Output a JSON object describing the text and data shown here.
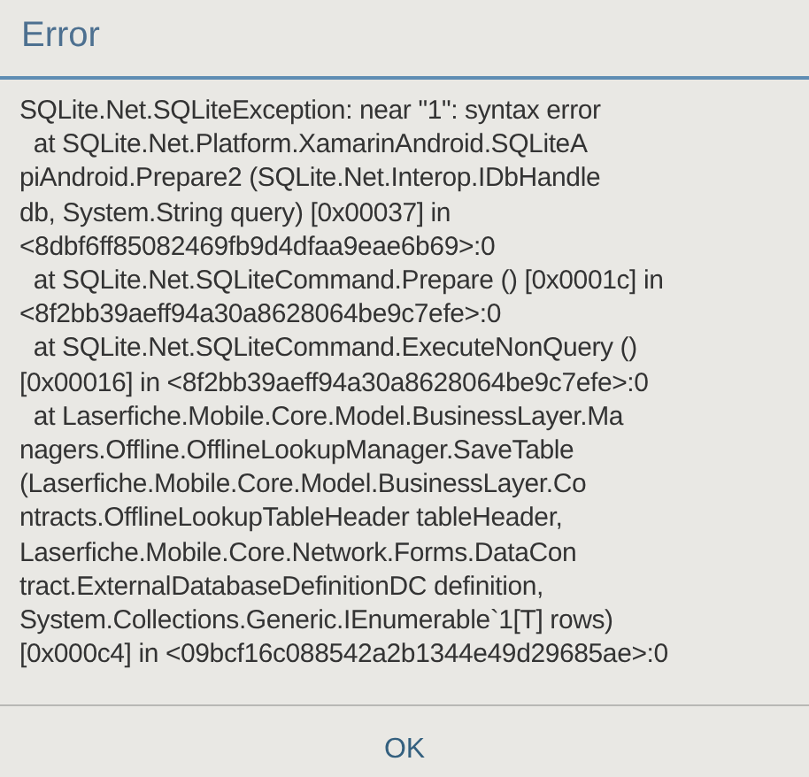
{
  "dialog": {
    "title": "Error",
    "message_lines": [
      "SQLite.Net.SQLiteException: near \"1\": syntax error",
      "  at SQLite.Net.Platform.XamarinAndroid.SQLiteA",
      "piAndroid.Prepare2 (SQLite.Net.Interop.IDbHandle",
      "db, System.String query) [0x00037] in",
      "<8dbf6ff85082469fb9d4dfaa9eae6b69>:0",
      "  at SQLite.Net.SQLiteCommand.Prepare () [0x0001c] in",
      "<8f2bb39aeff94a30a8628064be9c7efe>:0",
      "  at SQLite.Net.SQLiteCommand.ExecuteNonQuery ()",
      "[0x00016] in <8f2bb39aeff94a30a8628064be9c7efe>:0",
      "  at Laserfiche.Mobile.Core.Model.BusinessLayer.Ma",
      "nagers.Offline.OfflineLookupManager.SaveTable",
      "(Laserfiche.Mobile.Core.Model.BusinessLayer.Co",
      "ntracts.OfflineLookupTableHeader tableHeader,",
      "Laserfiche.Mobile.Core.Network.Forms.DataCon",
      "tract.ExternalDatabaseDefinitionDC definition,",
      "System.Collections.Generic.IEnumerable`1[T] rows)",
      "[0x000c4] in <09bcf16c088542a2b1344e49d29685ae>:0"
    ],
    "buttons": [
      {
        "label": "OK"
      }
    ]
  }
}
